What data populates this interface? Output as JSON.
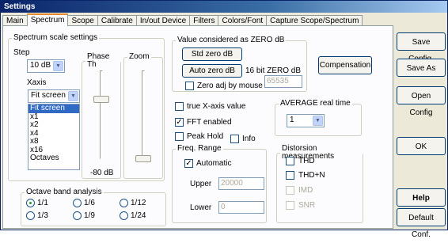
{
  "window": {
    "title": "Settings"
  },
  "tabs": [
    {
      "label": "Main"
    },
    {
      "label": "Spectrum"
    },
    {
      "label": "Scope"
    },
    {
      "label": "Calibrate"
    },
    {
      "label": "In/out Device"
    },
    {
      "label": "Filters"
    },
    {
      "label": "Colors/Font"
    },
    {
      "label": "Capture Scope/Spectrum"
    }
  ],
  "active_tab": "Spectrum",
  "scale": {
    "legend": "Spectrum scale settings",
    "step_label": "Step",
    "step_value": "10 dB",
    "xaxis_label": "Xaxis",
    "xaxis_value": "Fit screen",
    "xaxis_options": [
      "Fit screen",
      "x1",
      "x2",
      "x4",
      "x8",
      "x16",
      "Octaves"
    ],
    "phase_label": "Phase Th",
    "phase_value": "-80 dB",
    "zoom_label": "Zoom"
  },
  "zero_db": {
    "legend": "Value considered as ZERO dB",
    "std_button": "Std zero dB",
    "auto_button": "Auto zero dB",
    "bit_label": "16 bit ZERO dB",
    "bit_value": "65535",
    "adj_label": "Zero adj by mouse",
    "adj_checked": false
  },
  "compensation_button": "Compensation",
  "options": {
    "true_x": {
      "label": "true X-axis value",
      "checked": false
    },
    "fft": {
      "label": "FFT enabled",
      "checked": true
    },
    "peak": {
      "label": "Peak Hold",
      "checked": false
    },
    "info": {
      "label": "Info",
      "checked": false
    }
  },
  "average": {
    "legend": "AVERAGE real time",
    "value": "1"
  },
  "freq": {
    "legend": "Freq. Range",
    "automatic_label": "Automatic",
    "automatic_checked": true,
    "upper_label": "Upper",
    "upper_value": "20000",
    "lower_label": "Lower",
    "lower_value": "0"
  },
  "distortion": {
    "legend": "Distorsion measurements",
    "items": [
      {
        "label": "THD",
        "enabled": true
      },
      {
        "label": "THD+N",
        "enabled": true
      },
      {
        "label": "IMD",
        "enabled": false
      },
      {
        "label": "SNR",
        "enabled": false
      }
    ]
  },
  "octave": {
    "legend": "Octave band analysis",
    "options": [
      "1/1",
      "1/6",
      "1/12",
      "1/3",
      "1/9",
      "1/24"
    ],
    "selected": "1/1"
  },
  "right_buttons": {
    "save_config": "Save Config.",
    "save_as": "Save As",
    "open_config": "Open Config",
    "ok": "OK",
    "help": "Help",
    "default_conf": "Default Conf."
  },
  "glyphs": {
    "check": "✓",
    "arrow": "▼"
  },
  "colors": {
    "accent": "#316ac5",
    "tab_highlight": "#e68b2c",
    "title_bar": "#0a246a"
  }
}
